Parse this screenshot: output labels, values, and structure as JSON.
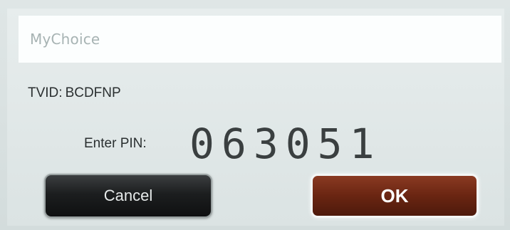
{
  "app": {
    "title": "MyChoice"
  },
  "tv": {
    "label": "TVID:",
    "id": "BCDFNP"
  },
  "pin": {
    "label": "Enter PIN:",
    "value": "063051"
  },
  "buttons": {
    "cancel_label": "Cancel",
    "ok_label": "OK"
  },
  "colors": {
    "background": "#d8e0e0",
    "title_bar": "#fcfefe",
    "cancel_button": "#1c1e1f",
    "ok_button": "#6a2512"
  }
}
